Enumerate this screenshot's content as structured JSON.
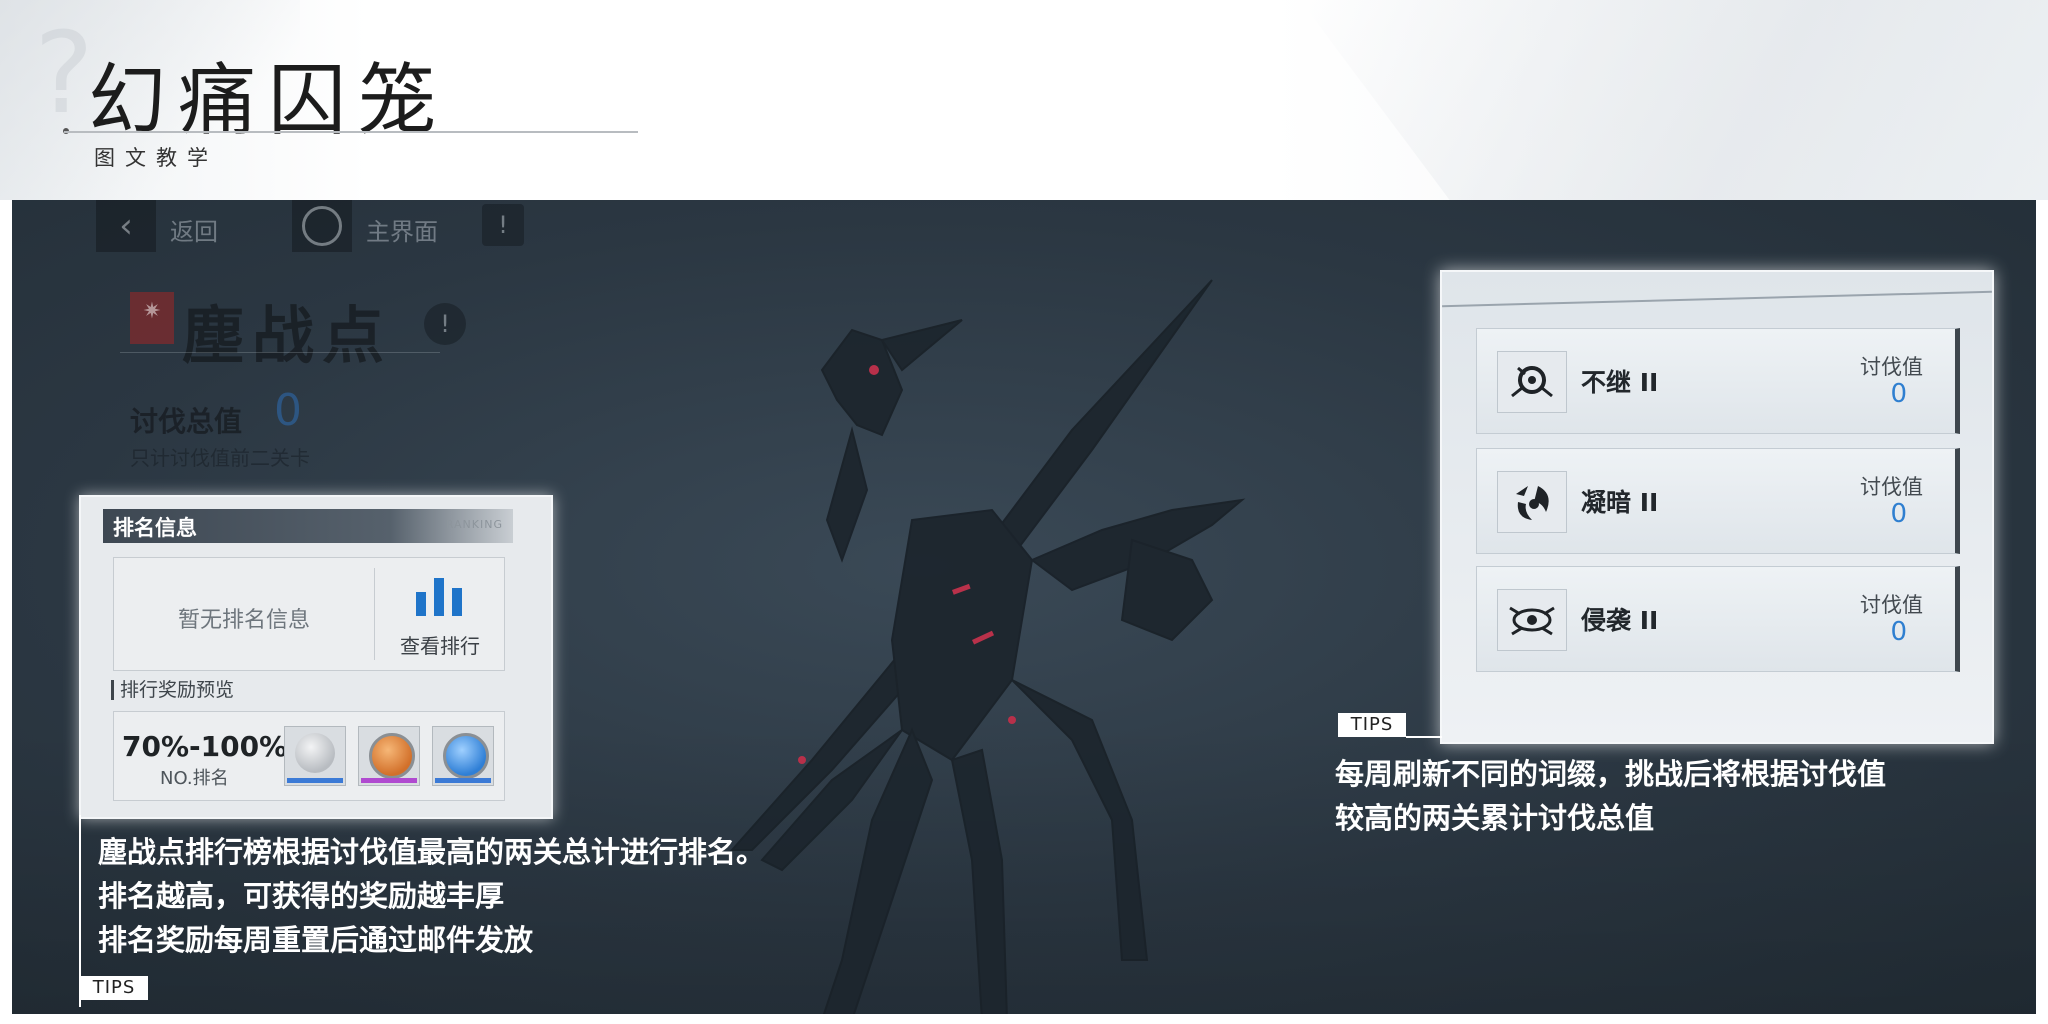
{
  "header": {
    "title": "幻痛囚笼",
    "subtitle": "图文教学"
  },
  "game_ui": {
    "back_label": "返回",
    "home_label": "主界面",
    "stage_name": "塵战点",
    "total_label": "讨伐总值",
    "total_value": "0",
    "total_note": "只计讨伐值前二关卡"
  },
  "ranking_panel": {
    "title": "排名信息",
    "tag": "RANKING",
    "no_rank_text": "暂无排名信息",
    "view_rank_label": "查看排行",
    "preview_label": "排行奖励预览",
    "reward_range": "70%-100%",
    "reward_rank_label": "NO.排名",
    "reward_items": [
      {
        "icon": "skull-item-icon",
        "color": "#c9cdd2",
        "strip": "#3b7ad6"
      },
      {
        "icon": "orange-coin-icon",
        "color": "#e08a3c",
        "strip": "#b04ad0"
      },
      {
        "icon": "blue-coin-icon",
        "color": "#3f8fe0",
        "strip": "#3b7ad6"
      }
    ]
  },
  "left_caption": {
    "lines": [
      "塵战点排行榜根据讨伐值最高的两关总计进行排名。",
      "排名越高，可获得的奖励越丰厚",
      "排名奖励每周重置后通过邮件发放"
    ],
    "tips_tag": "TIPS"
  },
  "affix_panel": {
    "value_label": "讨伐值",
    "affixes": [
      {
        "name": "不继 II",
        "value": "0",
        "icon": "break-affix-icon"
      },
      {
        "name": "凝暗 II",
        "value": "0",
        "icon": "dark-affix-icon"
      },
      {
        "name": "侵袭 II",
        "value": "0",
        "icon": "raid-affix-icon"
      }
    ]
  },
  "right_caption": {
    "lines": [
      "每周刷新不同的词缀，挑战后将根据讨伐值",
      "较高的两关累计讨伐总值"
    ],
    "tips_tag": "TIPS"
  }
}
